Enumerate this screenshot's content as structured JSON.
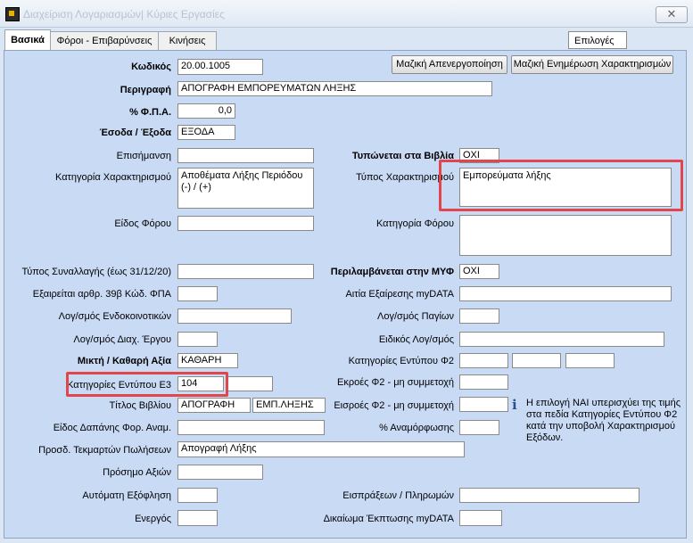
{
  "window": {
    "title": "Διαχείριση Λογαριασμών| Κύριες Εργασίες",
    "close_glyph": "✕"
  },
  "tabs": [
    "Βασικά",
    "Φόροι - Επιβαρύνσεις",
    "Κινήσεις"
  ],
  "options_label": "Επιλογές",
  "buttons": {
    "mass_deactivate": "Μαζική Απενεργοποίηση",
    "mass_update": "Μαζική Ενημέρωση Χαρακτηρισμών"
  },
  "left": {
    "code": {
      "label": "Κωδικός",
      "value": "20.00.1005"
    },
    "description": {
      "label": "Περιγραφή",
      "value": "ΑΠΟΓΡΑΦΗ ΕΜΠΟΡΕΥΜΑΤΩΝ ΛΗΞΗΣ"
    },
    "vat": {
      "label": "% Φ.Π.Α.",
      "value": "0,0"
    },
    "income_expense": {
      "label": "Έσοδα / Έξοδα",
      "value": "ΕΞΟΔΑ"
    },
    "mention": {
      "label": "Επισήμανση",
      "value": ""
    },
    "category": {
      "label": "Κατηγορία Χαρακτηρισμού",
      "value": "Αποθέματα Λήξης Περιόδου (-) / (+)"
    },
    "tax_type": {
      "label": "Είδος Φόρου",
      "value": ""
    },
    "transaction_type": {
      "label": "Τύπος Συναλλαγής (έως 31/12/20)",
      "value": ""
    },
    "exempt_39b": {
      "label": "Εξαιρείται αρθρ. 39β Κώδ. ΦΠΑ",
      "value": ""
    },
    "intra_community": {
      "label": "Λογ/σμός Ενδοκοινοτικών",
      "value": ""
    },
    "project": {
      "label": "Λογ/σμός Διαχ. Έργου",
      "value": ""
    },
    "gross_net": {
      "label": "Μικτή  / Καθαρή Αξία",
      "value": "ΚΑΘΑΡΗ"
    },
    "e3_categories": {
      "label": "Κατηγορίες Εντύπου Ε3",
      "value": "104",
      "value2": ""
    },
    "book_title": {
      "label": "Τίτλος Βιβλίου",
      "value": "ΑΠΟΓΡΑΦΗ",
      "value2": "ΕΜΠ.ΛΗΞΗΣ"
    },
    "expense_type": {
      "label": "Είδος Δαπάνης Φορ. Αναμ.",
      "value": ""
    },
    "sales_document": {
      "label": "Προσδ. Τεκμαρτών Πωλήσεων",
      "value": "Απογραφή Λήξης"
    },
    "value_sign": {
      "label": "Πρόσημο Αξιών",
      "value": ""
    },
    "auto_settlement": {
      "label": "Αυτόματη Εξόφληση",
      "value": ""
    },
    "active": {
      "label": "Ενεργός",
      "value": ""
    }
  },
  "right": {
    "printed_in_books": {
      "label": "Τυπώνεται στα Βιβλία",
      "value": "ΟΧΙ"
    },
    "category_type": {
      "label": "Τύπος Χαρακτηρισμού",
      "value": "Εμπορεύματα λήξης"
    },
    "tax_category": {
      "label": "Κατηγορία Φόρου",
      "value": ""
    },
    "included_myf": {
      "label": "Περιλαμβάνεται στην ΜΥΦ",
      "value": "ΟΧΙ"
    },
    "exemption_cause": {
      "label": "Αιτία Εξαίρεσης myDATA",
      "value": ""
    },
    "fixed_assets": {
      "label": "Λογ/σμός  Παγίων",
      "value": ""
    },
    "special_account": {
      "label": "Ειδικός Λογ/σμός",
      "value": ""
    },
    "f2_categories": {
      "label": "Κατηγορίες Εντύπου Φ2",
      "values": [
        "",
        "",
        ""
      ]
    },
    "f2_outflows": {
      "label": "Εκροές Φ2 - μη συμμετοχή",
      "value": ""
    },
    "f2_inflows": {
      "label": "Εισροές Φ2 - μη συμμετοχή",
      "value": ""
    },
    "adjustment": {
      "label": "% Αναμόρφωσης",
      "value": ""
    },
    "receipts_payments": {
      "label": "Εισπράξεων / Πληρωμών",
      "value": ""
    },
    "deduction_right": {
      "label": "Δικαίωμα Έκπτωσης myDATA",
      "value": ""
    }
  },
  "info_note": "Η επιλογή ΝΑΙ υπερισχύει της τιμής στα πεδία Κατηγορίες Εντύπου Φ2 κατά την υποβολή Χαρακτηρισμού Εξόδων."
}
